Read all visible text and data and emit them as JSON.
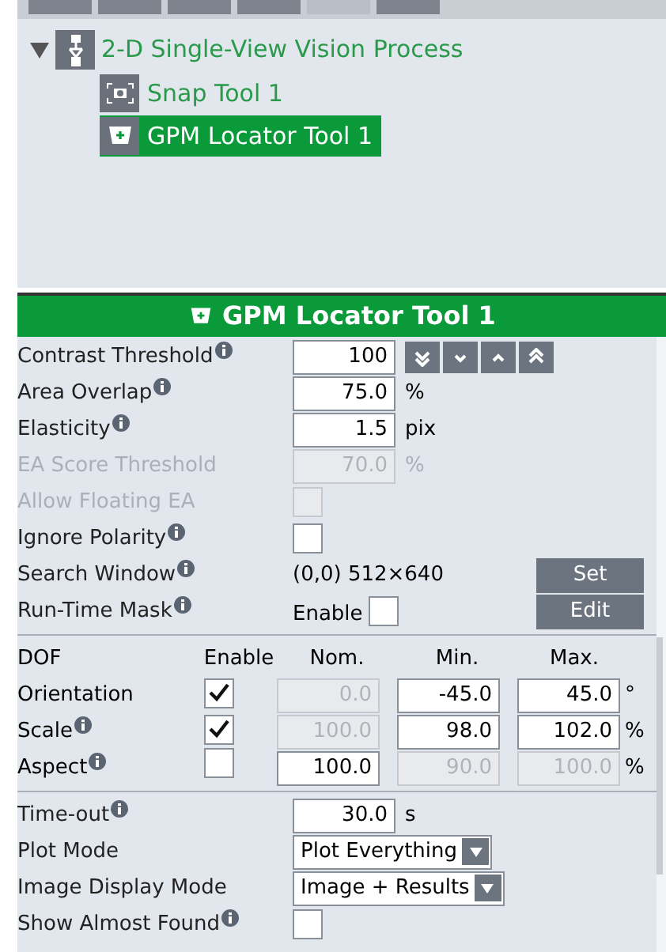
{
  "tree": {
    "label": "2-D Single-View Vision Process",
    "expanded": true,
    "children": [
      {
        "label": "Snap Tool 1",
        "kind": "snap",
        "selected": false
      },
      {
        "label": "GPM Locator Tool 1",
        "kind": "locator",
        "selected": true
      }
    ]
  },
  "panel_title": "GPM Locator Tool 1",
  "settings": [
    {
      "kind": "number",
      "label": "Contrast Threshold",
      "info": true,
      "value": "100",
      "steppers": true,
      "disabled": false
    },
    {
      "kind": "number",
      "label": "Area Overlap",
      "info": true,
      "value": "75.0",
      "unit": "%",
      "disabled": false
    },
    {
      "kind": "number",
      "label": "Elasticity",
      "info": true,
      "value": "1.5",
      "unit": "pix",
      "disabled": false
    },
    {
      "kind": "number",
      "label": "EA Score Threshold",
      "info": false,
      "value": "70.0",
      "unit": "%",
      "disabled": true
    },
    {
      "kind": "checkbox",
      "label": "Allow Floating EA",
      "info": false,
      "checked": false,
      "disabled": true
    },
    {
      "kind": "checkbox",
      "label": "Ignore Polarity",
      "info": true,
      "checked": false,
      "disabled": false
    },
    {
      "kind": "button",
      "label": "Search Window",
      "info": true,
      "value": "(0,0) 512×640",
      "button": "Set"
    },
    {
      "kind": "button",
      "label": "Run-Time Mask",
      "info": true,
      "check_label": "Enable",
      "checked": false,
      "button": "Edit"
    }
  ],
  "dof": {
    "columns": [
      "DOF",
      "Enable",
      "Nom.",
      "Min.",
      "Max."
    ],
    "rows": [
      {
        "label": "Orientation",
        "info": false,
        "enabled": true,
        "nom": "0.0",
        "min": "-45.0",
        "max": "45.0",
        "unit": "°"
      },
      {
        "label": "Scale",
        "info": true,
        "enabled": true,
        "nom": "100.0",
        "min": "98.0",
        "max": "102.0",
        "unit": "%"
      },
      {
        "label": "Aspect",
        "info": true,
        "enabled": false,
        "nom": "100.0",
        "min": "90.0",
        "max": "100.0",
        "unit": "%"
      }
    ]
  },
  "more_settings": [
    {
      "kind": "number",
      "label": "Time-out",
      "info": true,
      "value": "30.0",
      "unit": "s"
    },
    {
      "kind": "select",
      "label": "Plot Mode",
      "info": false,
      "value": "Plot Everything"
    },
    {
      "kind": "select",
      "label": "Image Display Mode",
      "info": false,
      "value": "Image + Results"
    },
    {
      "kind": "checkbox",
      "label": "Show Almost Found",
      "info": true,
      "checked": false
    }
  ]
}
